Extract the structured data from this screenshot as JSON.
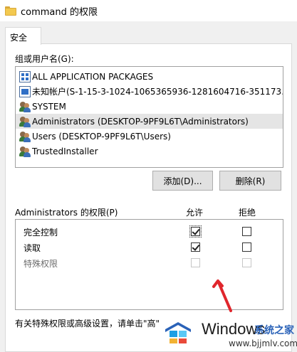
{
  "window": {
    "title": "command 的权限"
  },
  "tabs": [
    {
      "label": "安全"
    }
  ],
  "groups": {
    "label": "组或用户名(G):",
    "items": [
      {
        "name": "ALL APPLICATION PACKAGES",
        "icon": "app-packages-icon",
        "selected": false
      },
      {
        "name": "未知帐户(S-1-15-3-1024-1065365936-1281604716-351173...",
        "icon": "unknown-account-icon",
        "selected": false
      },
      {
        "name": "SYSTEM",
        "icon": "users-icon",
        "selected": false
      },
      {
        "name": "Administrators (DESKTOP-9PF9L6T\\Administrators)",
        "icon": "users-icon",
        "selected": true
      },
      {
        "name": "Users (DESKTOP-9PF9L6T\\Users)",
        "icon": "users-icon",
        "selected": false
      },
      {
        "name": "TrustedInstaller",
        "icon": "users-icon",
        "selected": false
      }
    ]
  },
  "buttons": {
    "add": "添加(D)...",
    "remove": "删除(R)"
  },
  "permissions": {
    "title": "Administrators 的权限(P)",
    "allow_label": "允许",
    "deny_label": "拒绝",
    "rows": [
      {
        "label": "完全控制",
        "allow": true,
        "deny": false,
        "enabled": true
      },
      {
        "label": "读取",
        "allow": true,
        "deny": false,
        "enabled": true
      },
      {
        "label": "特殊权限",
        "allow": false,
        "deny": false,
        "enabled": false
      }
    ]
  },
  "hint": "有关特殊权限或高级设置，请单击\"高\"",
  "annotation": {
    "arrow_color": "#e0262c"
  },
  "watermark": {
    "brand": "Windows",
    "cn": "系统之家",
    "url": "www.bjjmlv.com"
  }
}
